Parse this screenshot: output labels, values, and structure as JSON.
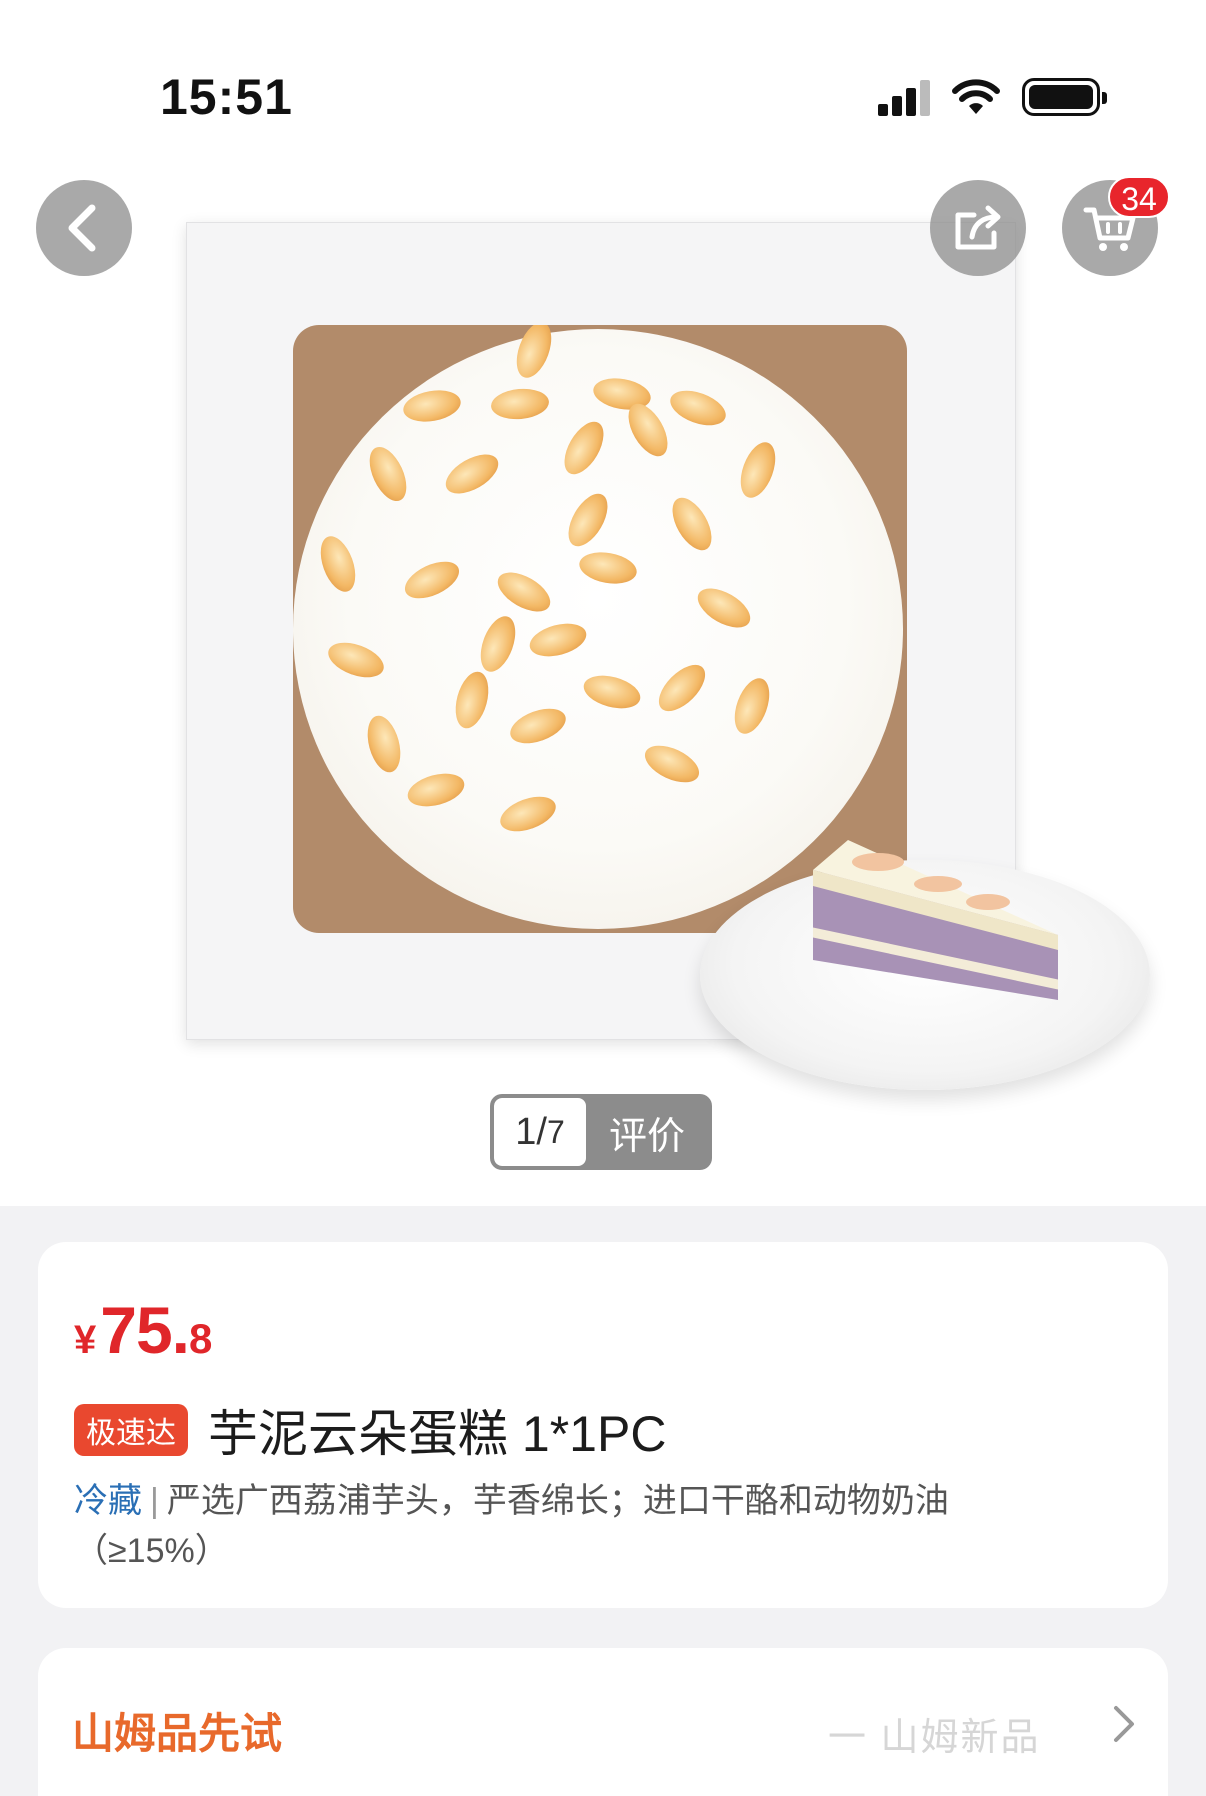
{
  "status_bar": {
    "time": "15:51",
    "icons": [
      "cellular-signal-icon",
      "wifi-icon",
      "battery-icon"
    ]
  },
  "header": {
    "back_icon": "chevron-left-icon",
    "share_icon": "share-icon",
    "cart_icon": "cart-icon",
    "cart_badge": "34"
  },
  "gallery": {
    "counter_current": "1",
    "counter_total": "7",
    "review_label": "评价"
  },
  "product": {
    "price_currency": "¥",
    "price_integer": "75.",
    "price_decimal": "8",
    "express_tag": "极速达",
    "title": "芋泥云朵蛋糕 1*1PC",
    "storage": "冷藏",
    "separator": "|",
    "description": "严选广西荔浦芋头，芋香绵长；进口干酪和动物奶油（≥15%）"
  },
  "trial": {
    "title": "山姆品先试",
    "faded_text": "一 山姆新品"
  },
  "colors": {
    "price_red": "#e0262a",
    "badge_red": "#e8252c",
    "express_orange": "#e9482f",
    "trial_orange": "#e8692b",
    "storage_blue": "#2a6fb5"
  }
}
